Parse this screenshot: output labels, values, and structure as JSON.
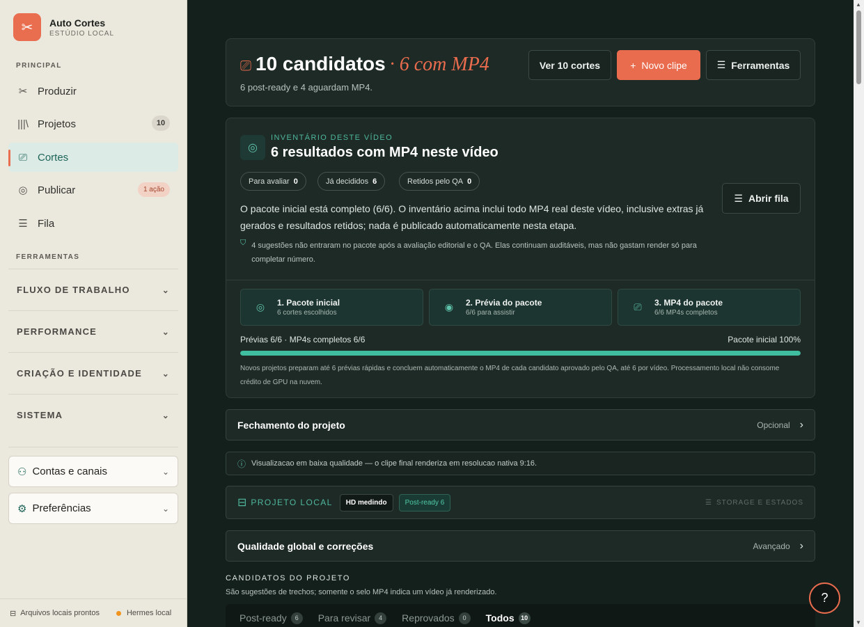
{
  "brand": {
    "title": "Auto Cortes",
    "subtitle": "ESTÚDIO LOCAL"
  },
  "sidebar": {
    "section_principal": "PRINCIPAL",
    "items": [
      {
        "label": "Produzir"
      },
      {
        "label": "Projetos",
        "badge": "10"
      },
      {
        "label": "Cortes"
      },
      {
        "label": "Publicar",
        "badge": "1 ação"
      },
      {
        "label": "Fila"
      }
    ],
    "section_ferramentas": "FERRAMENTAS",
    "groups": [
      "FLUXO DE TRABALHO",
      "PERFORMANCE",
      "CRIAÇÃO E IDENTIDADE",
      "SISTEMA"
    ],
    "accounts": "Contas e canais",
    "preferences": "Preferências",
    "footer_files": "Arquivos locais prontos",
    "footer_hermes": "Hermes local"
  },
  "header": {
    "title": "10 candidatos",
    "title_accent": "· 6 com MP4",
    "subtitle": "6 post-ready e 4 aguardam MP4.",
    "btn_view": "Ver 10 cortes",
    "btn_new": "Novo clipe",
    "btn_tools": "Ferramentas"
  },
  "inventory": {
    "eyebrow": "INVENTÁRIO DESTE VÍDEO",
    "title": "6 resultados com MP4 neste vídeo",
    "pills": [
      {
        "label": "Para avaliar",
        "value": "0"
      },
      {
        "label": "Já decididos",
        "value": "6"
      },
      {
        "label": "Retidos pelo QA",
        "value": "0"
      }
    ],
    "btn_queue": "Abrir fila",
    "description": "O pacote inicial está completo (6/6). O inventário acima inclui todo MP4 real deste vídeo, inclusive extras já gerados e resultados retidos; nada é publicado automaticamente nesta etapa.",
    "note": "4 sugestões não entraram no pacote após a avaliação editorial e o QA. Elas continuam auditáveis, mas não gastam render só para completar número.",
    "steps": [
      {
        "title": "1. Pacote inicial",
        "sub": "6 cortes escolhidos"
      },
      {
        "title": "2. Prévia do pacote",
        "sub": "6/6 para assistir"
      },
      {
        "title": "3. MP4 do pacote",
        "sub": "6/6 MP4s completos"
      }
    ],
    "progress_left": "Prévias 6/6 · MP4s completos 6/6",
    "progress_right": "Pacote inicial 100%",
    "progress_value": 1.0,
    "footnote": "Novos projetos preparam até 6 prévias rápidas e concluem automaticamente o MP4 de cada candidato aprovado pelo QA, até 6 por vídeo. Processamento local não consome crédito de GPU na nuvem."
  },
  "closing": {
    "title": "Fechamento do projeto",
    "tag": "Opcional"
  },
  "notice": "Visualizacao em baixa qualidade — o clipe final renderiza em resolucao nativa 9:16.",
  "local": {
    "label": "PROJETO LOCAL",
    "chip_hd": "HD medindo",
    "chip_ready": "Post-ready 6",
    "storage": "STORAGE E ESTADOS"
  },
  "quality": {
    "title": "Qualidade global e correções",
    "tag": "Avançado"
  },
  "candidates": {
    "heading": "CANDIDATOS DO PROJETO",
    "sub": "São sugestões de trechos; somente o selo MP4 indica um vídeo já renderizado.",
    "tabs": [
      {
        "label": "Post-ready",
        "count": "6"
      },
      {
        "label": "Para revisar",
        "count": "4"
      },
      {
        "label": "Reprovados",
        "count": "0"
      },
      {
        "label": "Todos",
        "count": "10"
      }
    ]
  },
  "colors": {
    "accent": "#ea6c4e",
    "teal": "#3fbf9f",
    "bg": "#14201c",
    "sidebar": "#ebe8de"
  }
}
